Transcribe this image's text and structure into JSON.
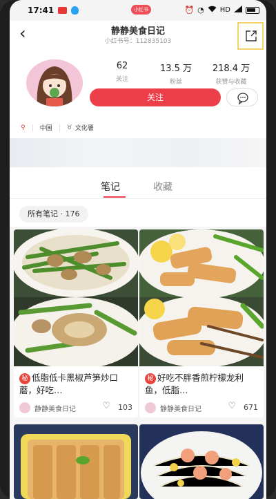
{
  "status_bar": {
    "time": "17:41",
    "badge": "小红书",
    "network": "HD",
    "icons": [
      "alarm-icon",
      "mute-icon",
      "wifi-icon",
      "signal-icon",
      "battery-icon"
    ]
  },
  "header": {
    "title": "静静美食日记",
    "subtitle": "小红书号：112835103",
    "back_icon": "chevron-left-icon",
    "share_icon": "share-export-icon"
  },
  "profile": {
    "stats": [
      {
        "value": "62",
        "label": "关注"
      },
      {
        "value": "13.5 万",
        "label": "粉丝"
      },
      {
        "value": "218.4 万",
        "label": "获赞与收藏"
      }
    ],
    "follow_label": "关注",
    "message_icon": "chat-bubble-icon",
    "tags": [
      "中国",
      "文化署"
    ]
  },
  "tabs": {
    "items": [
      "笔记",
      "收藏"
    ],
    "active": "笔记"
  },
  "filter": {
    "label": "所有笔记 · 176"
  },
  "notes": [
    {
      "badge": "秘",
      "title": "低脂低卡黑椒芦笋炒口蘑，好吃…",
      "author": "静静美食日记",
      "likes": "103"
    },
    {
      "badge": "秘",
      "title": "好吃不胖香煎柠檬龙利鱼，低脂…",
      "author": "静静美食日记",
      "likes": "671"
    }
  ],
  "colors": {
    "accent": "#ed3f4a",
    "highlight_box": "#f3d36b"
  }
}
